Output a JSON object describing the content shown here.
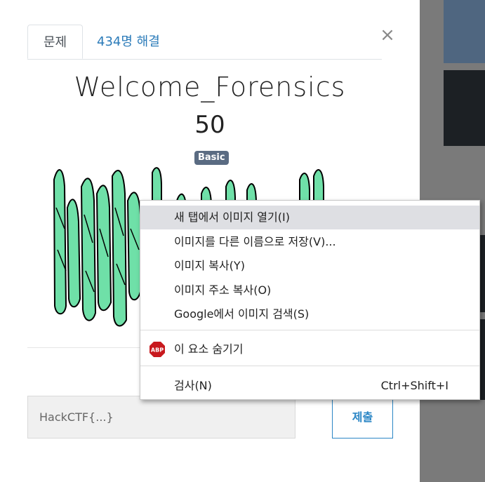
{
  "modal": {
    "tabs": [
      {
        "label": "문제"
      },
      {
        "label": "434명 해결"
      }
    ],
    "close_symbol": "×",
    "title": "Welcome_Forensics",
    "points": "50",
    "badge": "Basic",
    "flag_placeholder": "HackCTF{...}",
    "submit_label": "제출"
  },
  "context_menu": {
    "items": [
      {
        "label": "새 탭에서 이미지 열기(I)"
      },
      {
        "label": "이미지를 다른 이름으로 저장(V)..."
      },
      {
        "label": "이미지 복사(Y)"
      },
      {
        "label": "이미지 주소 복사(O)"
      },
      {
        "label": "Google에서 이미지 검색(S)"
      },
      {
        "label": "이 요소 숨기기"
      },
      {
        "label": "검사(N)",
        "shortcut": "Ctrl+Shift+I"
      }
    ],
    "abp_icon_text": "ABP"
  },
  "colors": {
    "accent": "#2b86c5",
    "badge": "#5a6b82",
    "menu_highlight": "#dedfe3",
    "abp_red": "#c8191e",
    "captcha_green": "#6fe0a8"
  }
}
